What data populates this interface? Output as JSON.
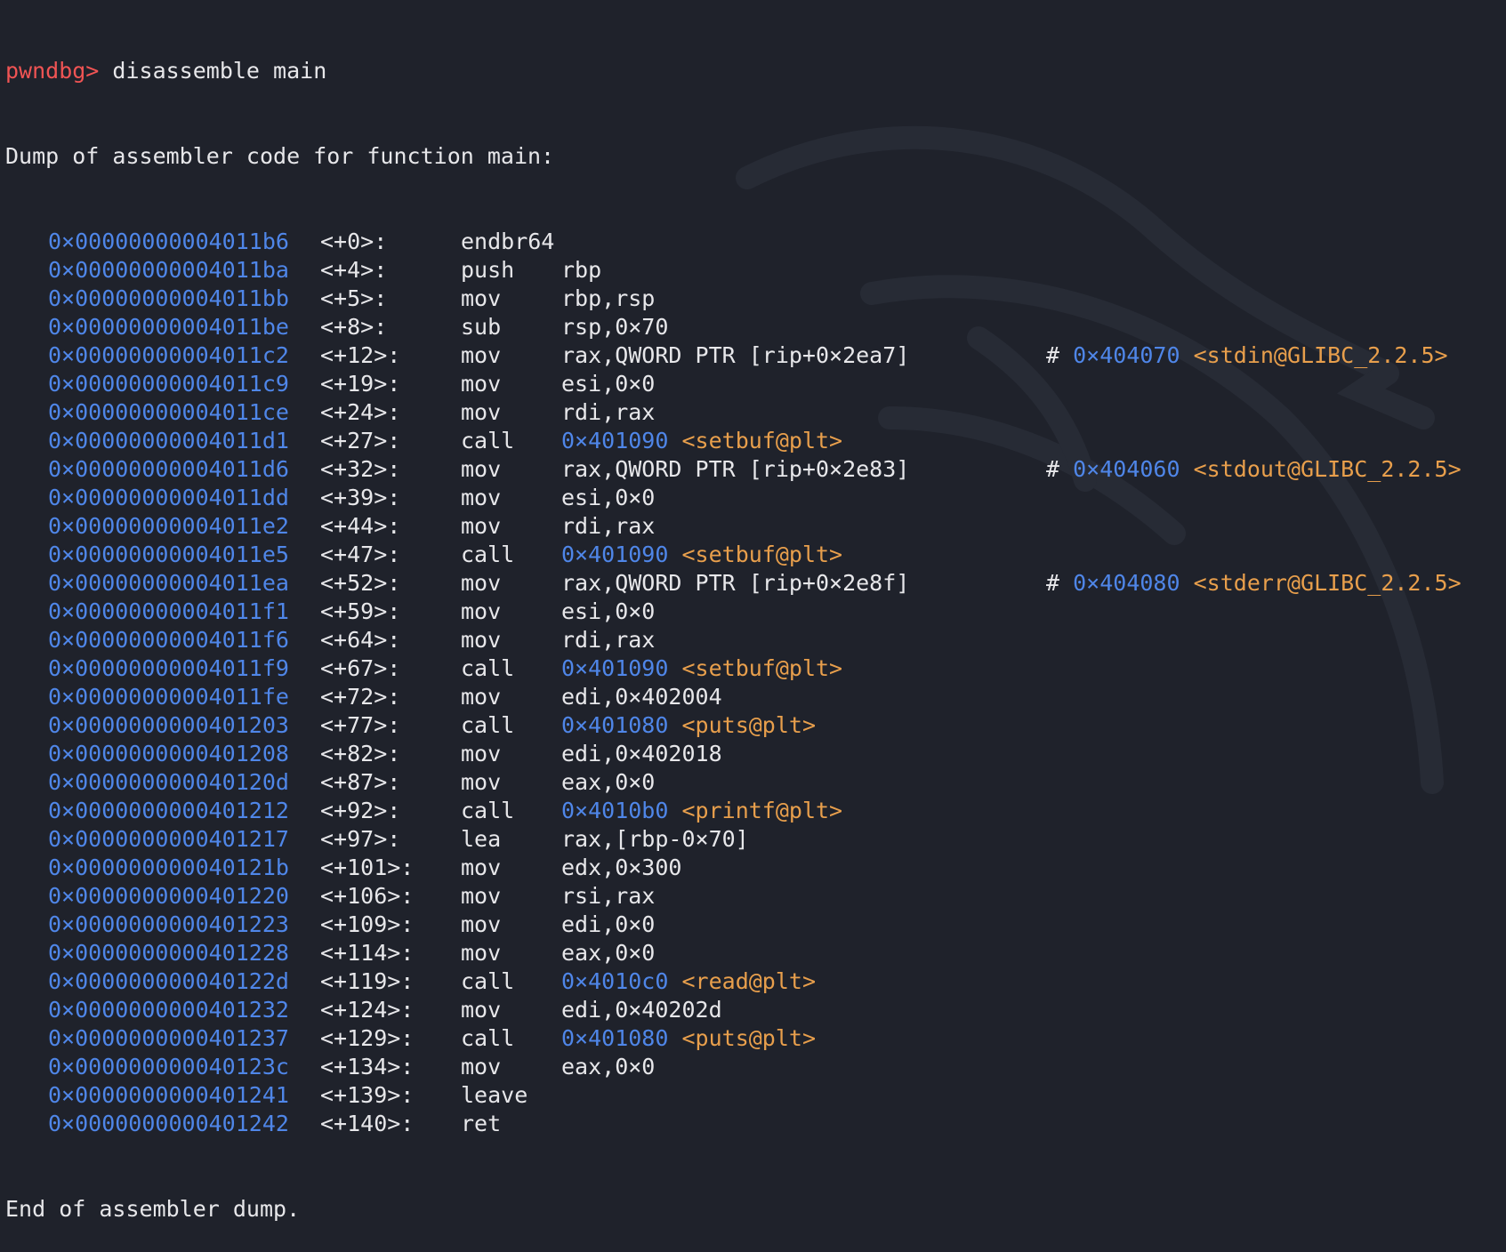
{
  "prompt": "pwndbg>",
  "command": "disassemble main",
  "header": "Dump of assembler code for function main:",
  "footer": "End of assembler dump.",
  "colors": {
    "background": "#1f222b",
    "prompt": "#f05454",
    "address": "#4f86e8",
    "symbol": "#e89f4c",
    "text": "#e7e7ea"
  },
  "instructions": [
    {
      "addr": "0×00000000004011b6",
      "offset": "<+0>:",
      "mnemonic": "endbr64",
      "operands": ""
    },
    {
      "addr": "0×00000000004011ba",
      "offset": "<+4>:",
      "mnemonic": "push",
      "operands": "rbp"
    },
    {
      "addr": "0×00000000004011bb",
      "offset": "<+5>:",
      "mnemonic": "mov",
      "operands": "rbp,rsp"
    },
    {
      "addr": "0×00000000004011be",
      "offset": "<+8>:",
      "mnemonic": "sub",
      "operands": "rsp,0×70"
    },
    {
      "addr": "0×00000000004011c2",
      "offset": "<+12>:",
      "mnemonic": "mov",
      "operands": "rax,QWORD PTR [rip+0×2ea7]",
      "comment": "#",
      "comment_addr": "0×404070",
      "comment_sym": "<stdin@GLIBC_2.2.5>"
    },
    {
      "addr": "0×00000000004011c9",
      "offset": "<+19>:",
      "mnemonic": "mov",
      "operands": "esi,0×0"
    },
    {
      "addr": "0×00000000004011ce",
      "offset": "<+24>:",
      "mnemonic": "mov",
      "operands": "rdi,rax"
    },
    {
      "addr": "0×00000000004011d1",
      "offset": "<+27>:",
      "mnemonic": "call",
      "target": "0×401090",
      "target_sym": "<setbuf@plt>"
    },
    {
      "addr": "0×00000000004011d6",
      "offset": "<+32>:",
      "mnemonic": "mov",
      "operands": "rax,QWORD PTR [rip+0×2e83]",
      "comment": "#",
      "comment_addr": "0×404060",
      "comment_sym": "<stdout@GLIBC_2.2.5>"
    },
    {
      "addr": "0×00000000004011dd",
      "offset": "<+39>:",
      "mnemonic": "mov",
      "operands": "esi,0×0"
    },
    {
      "addr": "0×00000000004011e2",
      "offset": "<+44>:",
      "mnemonic": "mov",
      "operands": "rdi,rax"
    },
    {
      "addr": "0×00000000004011e5",
      "offset": "<+47>:",
      "mnemonic": "call",
      "target": "0×401090",
      "target_sym": "<setbuf@plt>"
    },
    {
      "addr": "0×00000000004011ea",
      "offset": "<+52>:",
      "mnemonic": "mov",
      "operands": "rax,QWORD PTR [rip+0×2e8f]",
      "comment": "#",
      "comment_addr": "0×404080",
      "comment_sym": "<stderr@GLIBC_2.2.5>"
    },
    {
      "addr": "0×00000000004011f1",
      "offset": "<+59>:",
      "mnemonic": "mov",
      "operands": "esi,0×0"
    },
    {
      "addr": "0×00000000004011f6",
      "offset": "<+64>:",
      "mnemonic": "mov",
      "operands": "rdi,rax"
    },
    {
      "addr": "0×00000000004011f9",
      "offset": "<+67>:",
      "mnemonic": "call",
      "target": "0×401090",
      "target_sym": "<setbuf@plt>"
    },
    {
      "addr": "0×00000000004011fe",
      "offset": "<+72>:",
      "mnemonic": "mov",
      "operands": "edi,0×402004"
    },
    {
      "addr": "0×0000000000401203",
      "offset": "<+77>:",
      "mnemonic": "call",
      "target": "0×401080",
      "target_sym": "<puts@plt>"
    },
    {
      "addr": "0×0000000000401208",
      "offset": "<+82>:",
      "mnemonic": "mov",
      "operands": "edi,0×402018"
    },
    {
      "addr": "0×000000000040120d",
      "offset": "<+87>:",
      "mnemonic": "mov",
      "operands": "eax,0×0"
    },
    {
      "addr": "0×0000000000401212",
      "offset": "<+92>:",
      "mnemonic": "call",
      "target": "0×4010b0",
      "target_sym": "<printf@plt>"
    },
    {
      "addr": "0×0000000000401217",
      "offset": "<+97>:",
      "mnemonic": "lea",
      "operands": "rax,[rbp-0×70]"
    },
    {
      "addr": "0×000000000040121b",
      "offset": "<+101>:",
      "mnemonic": "mov",
      "operands": "edx,0×300"
    },
    {
      "addr": "0×0000000000401220",
      "offset": "<+106>:",
      "mnemonic": "mov",
      "operands": "rsi,rax"
    },
    {
      "addr": "0×0000000000401223",
      "offset": "<+109>:",
      "mnemonic": "mov",
      "operands": "edi,0×0"
    },
    {
      "addr": "0×0000000000401228",
      "offset": "<+114>:",
      "mnemonic": "mov",
      "operands": "eax,0×0"
    },
    {
      "addr": "0×000000000040122d",
      "offset": "<+119>:",
      "mnemonic": "call",
      "target": "0×4010c0",
      "target_sym": "<read@plt>"
    },
    {
      "addr": "0×0000000000401232",
      "offset": "<+124>:",
      "mnemonic": "mov",
      "operands": "edi,0×40202d"
    },
    {
      "addr": "0×0000000000401237",
      "offset": "<+129>:",
      "mnemonic": "call",
      "target": "0×401080",
      "target_sym": "<puts@plt>"
    },
    {
      "addr": "0×000000000040123c",
      "offset": "<+134>:",
      "mnemonic": "mov",
      "operands": "eax,0×0"
    },
    {
      "addr": "0×0000000000401241",
      "offset": "<+139>:",
      "mnemonic": "leave",
      "operands": ""
    },
    {
      "addr": "0×0000000000401242",
      "offset": "<+140>:",
      "mnemonic": "ret",
      "operands": ""
    }
  ]
}
